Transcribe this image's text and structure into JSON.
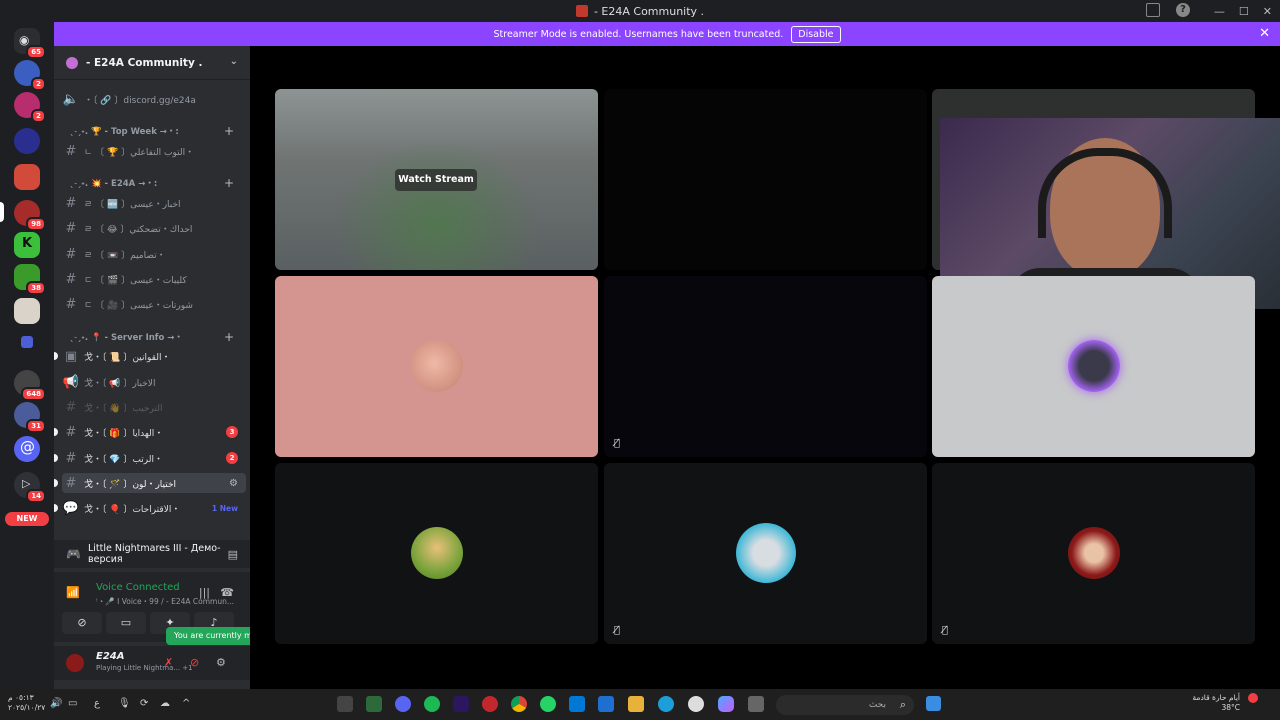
{
  "window": {
    "title": "- E24A Community ."
  },
  "banner": {
    "text": "Streamer Mode is enabled. Usernames have been truncated.",
    "disable_label": "Disable"
  },
  "guilds": [
    {
      "badge": "65",
      "color": "#5865f2"
    },
    {
      "badge": "2",
      "color": "#3b5fc0"
    },
    {
      "badge": "2",
      "color": "#b82d6e"
    },
    {
      "badge": "",
      "color": "#2a2f8f"
    },
    {
      "badge": "",
      "color": "#d24a3a"
    },
    {
      "badge": "98",
      "color": "#a62b2b"
    },
    {
      "badge": "",
      "color": "#3cc03c"
    },
    {
      "badge": "38",
      "color": "#3a9b2b"
    },
    {
      "badge": "",
      "color": "#d9d3c9"
    },
    {
      "badge": "",
      "color": "#4c5fd6"
    },
    {
      "badge": "648",
      "color": "#444"
    },
    {
      "badge": "31",
      "color": "#4a5d9a"
    },
    {
      "badge": "",
      "color": "#5865f2"
    },
    {
      "badge": "14",
      "color": "#2f3136"
    }
  ],
  "new_label": "NEW",
  "server": {
    "name": "- E24A Community ."
  },
  "channels": {
    "invite": "・〔 🔗 〕discord.gg/e24a",
    "cat_top_week": "ˎ˗ˏ˖. 🏆 - Top Week →・:",
    "top_week_1": "ㄴ 〔 🏆 〕التوب التفاعلي・",
    "cat_e24a": "ˎ˗ˏ˖. 💥 - E24A →・:",
    "e24a_1": "ㄹ 〔 🆕 〕اخبار・عيسى",
    "e24a_2": "ㄹ 〔 😂 〕احداك・تضحكني",
    "e24a_3": "ㄹ 〔 📼 〕تصاميم・",
    "e24a_4": "ㄷ 〔 🎬 〕كليبات・عيسى",
    "e24a_5": "ㄷ 〔 🎥 〕شورتات・عيسى",
    "cat_server_info": "ˎ˗ˏ˖. 📍 - Server Info →・",
    "info_1": "戈・〔 📜 〕القوانين・",
    "info_2": "戈・〔 📢 〕الاخبار",
    "info_3": "戈・〔 👋 〕الترحيب",
    "info_4": "戈・〔 🎁 〕الهدايا・",
    "info_4_badge": "3",
    "info_5": "戈・〔 💎 〕الرتب・",
    "info_5_badge": "2",
    "info_6": "戈・〔 🪄 〕اختيار・لون",
    "info_7": "戈・〔 🎈 〕الاقتراحات・",
    "info_7_new": "1 New"
  },
  "activity": {
    "game": "Little Nightmares III - Демо-версия"
  },
  "voice": {
    "status": "Voice Connected",
    "sub": "ꜝ・🎤 I Voice・99 / - E24A Commun..."
  },
  "tooltip": {
    "muted": "You are currently muted!"
  },
  "user": {
    "name": "E24A",
    "status": "Playing Little Nightma...",
    "extra": "+1"
  },
  "stage": {
    "watch_label": "Watch Stream"
  },
  "taskbar": {
    "search_placeholder": "بحث",
    "time": "٠٥:١٣ م",
    "date": "٢٠٢٥/١٠/٢٧",
    "weather_title": "أيام حارة قادمة",
    "weather_temp": "38°C"
  },
  "colors": {
    "accent": "#5865f2",
    "banner": "#8b44ff",
    "voice_green": "#23a55a",
    "alert_red": "#f23f43"
  }
}
